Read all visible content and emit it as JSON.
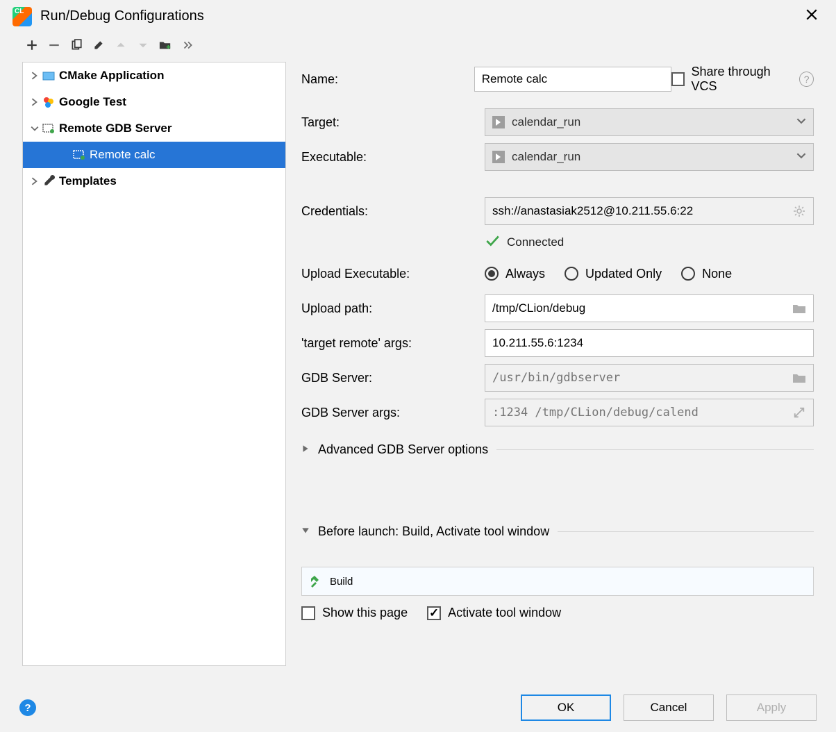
{
  "window": {
    "title": "Run/Debug Configurations"
  },
  "tree": {
    "items": [
      {
        "label": "CMake Application"
      },
      {
        "label": "Google Test"
      },
      {
        "label": "Remote GDB Server"
      },
      {
        "label": "Remote calc"
      },
      {
        "label": "Templates"
      }
    ]
  },
  "form": {
    "name_label": "Name:",
    "name_value": "Remote calc",
    "share_label": "Share through VCS",
    "target_label": "Target:",
    "target_value": "calendar_run",
    "exec_label": "Executable:",
    "exec_value": "calendar_run",
    "creds_label": "Credentials:",
    "creds_value": "ssh://anastasiak2512@10.211.55.6:22",
    "status_text": "Connected",
    "upload_exec_label": "Upload Executable:",
    "radios": {
      "always": "Always",
      "updated": "Updated Only",
      "none": "None"
    },
    "upload_path_label": "Upload path:",
    "upload_path_value": "/tmp/CLion/debug",
    "target_remote_label": "'target remote' args:",
    "target_remote_value": "10.211.55.6:1234",
    "gdb_server_label": "GDB Server:",
    "gdb_server_placeholder": "/usr/bin/gdbserver",
    "gdb_server_args_label": "GDB Server args:",
    "gdb_server_args_placeholder": ":1234 /tmp/CLion/debug/calend",
    "advanced_label": "Advanced GDB Server options"
  },
  "before_launch": {
    "header": "Before launch: Build, Activate tool window",
    "item": "Build",
    "show_page": "Show this page",
    "activate": "Activate tool window"
  },
  "footer": {
    "ok": "OK",
    "cancel": "Cancel",
    "apply": "Apply"
  }
}
